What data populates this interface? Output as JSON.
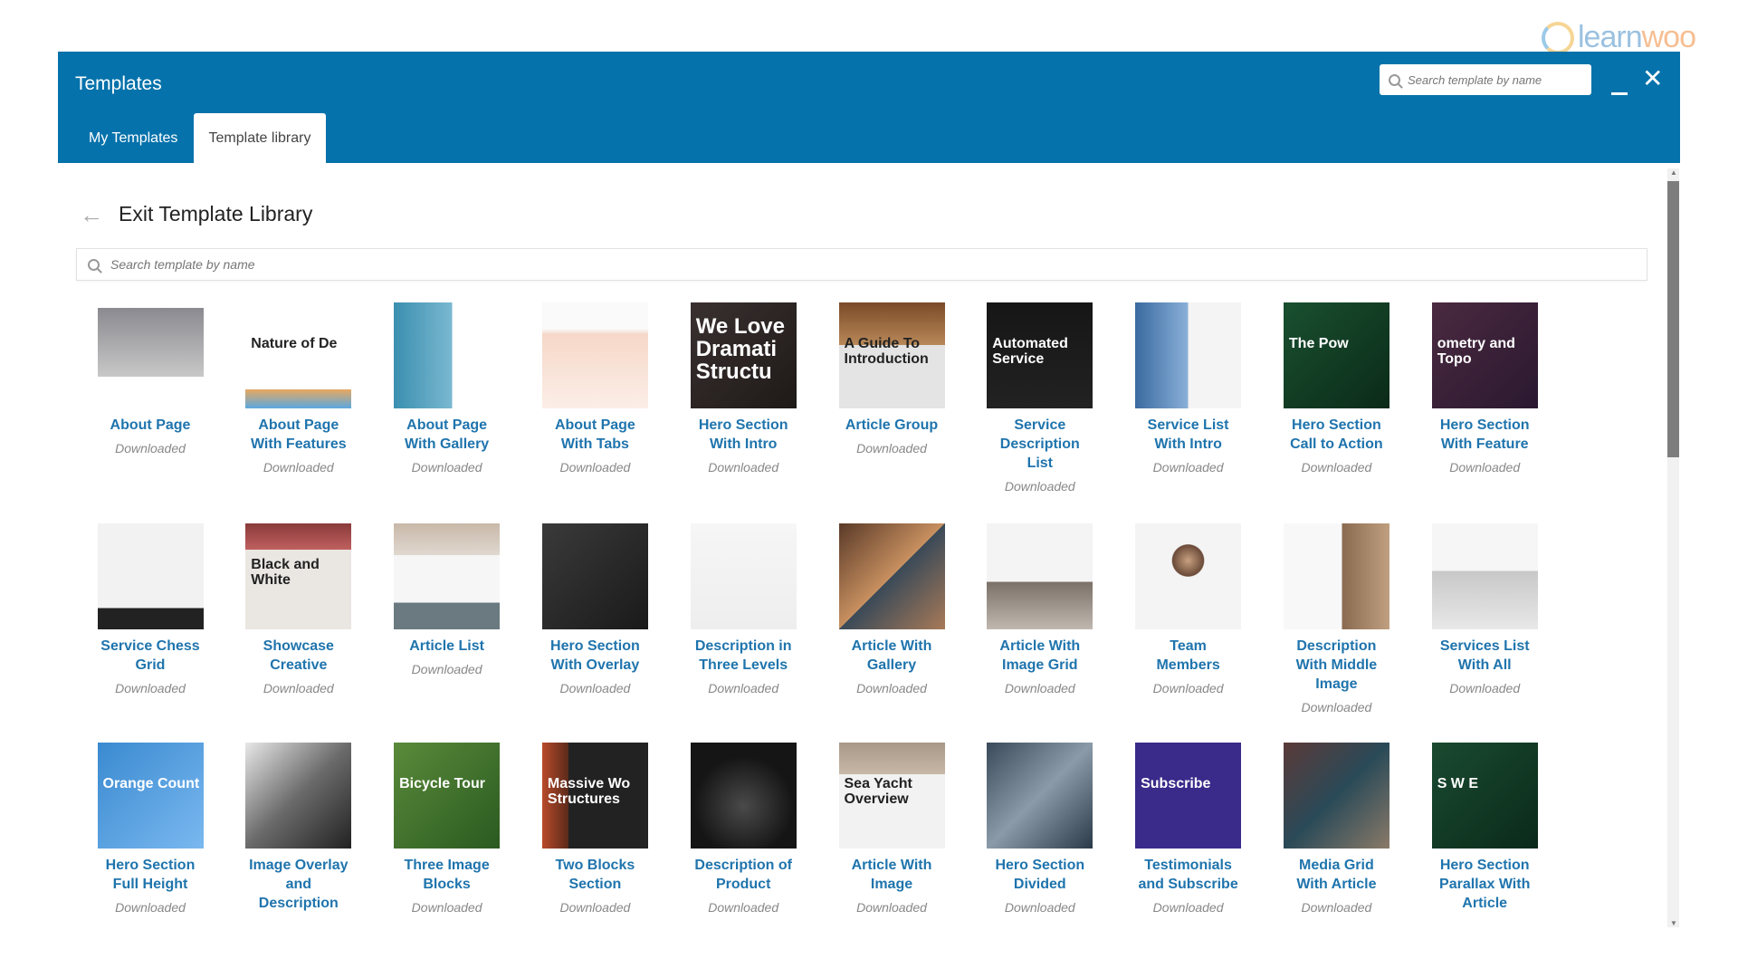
{
  "logo": {
    "text_a": "learn",
    "text_b": "woo"
  },
  "header": {
    "title": "Templates",
    "search_placeholder": "Search template by name",
    "minimize": "minimize",
    "close": "✕"
  },
  "tabs": [
    {
      "label": "My Templates",
      "active": false
    },
    {
      "label": "Template library",
      "active": true
    }
  ],
  "page": {
    "back_icon": "←",
    "title": "Exit Template Library",
    "search_placeholder": "Search template by name"
  },
  "colors": {
    "header": "#0572ab",
    "title": "#1f74ad"
  },
  "templates": [
    {
      "title": "About Page",
      "status": "Downloaded",
      "bg": "linear-gradient(#fff 0,#fff 5%,#8a8a90 5%,#c8c8c8 70%,#fff 70%)",
      "thumb_text": "",
      "tc": "#333"
    },
    {
      "title": "About Page\nWith Features",
      "status": "Downloaded",
      "bg": "linear-gradient(#fff 0,#fff 82%,#e8a860 82%,#5aa8e0 100%)",
      "thumb_text": "Nature of De",
      "tc": "#222"
    },
    {
      "title": "About Page\nWith Gallery",
      "status": "Downloaded",
      "bg": "linear-gradient(90deg,#3a8fb0 0,#7ab8d0 55%,#fff 55%)",
      "thumb_text": "",
      "tc": "#222"
    },
    {
      "title": "About Page\nWith Tabs",
      "status": "Downloaded",
      "bg": "linear-gradient(#fafafa 0,#fafafa 25%,#f6d8c8 30%,#fbeee8 100%)",
      "thumb_text": "",
      "tc": "#666"
    },
    {
      "title": "Hero Section\nWith Intro",
      "status": "Downloaded",
      "bg": "linear-gradient(135deg,#3a3030,#1e1a18)",
      "thumb_text": "We Love\nDramati\nStructu",
      "tc": "#fff"
    },
    {
      "title": "Article Group",
      "status": "Downloaded",
      "bg": "linear-gradient(#7a4a28 0,#b88858 40%,#e4e4e4 40%)",
      "thumb_text": "A Guide To\nIntroduction",
      "tc": "#222"
    },
    {
      "title": "Service\nDescription\nList",
      "status": "Downloaded",
      "bg": "linear-gradient(#161616,#222)",
      "thumb_text": "Automated\nService",
      "tc": "#fff"
    },
    {
      "title": "Service List\nWith Intro",
      "status": "Downloaded",
      "bg": "linear-gradient(90deg,#3a6aa0 0,#8ab0d8 50%,#f4f4f4 50%)",
      "thumb_text": "",
      "tc": "#222"
    },
    {
      "title": "Hero Section\nCall to Action",
      "status": "Downloaded",
      "bg": "linear-gradient(135deg,#1a5030,#0a2a18)",
      "thumb_text": "The Pow",
      "tc": "#fff"
    },
    {
      "title": "Hero Section\nWith Feature",
      "status": "Downloaded",
      "bg": "linear-gradient(135deg,#4a2a40,#2a1830)",
      "thumb_text": "ometry and Topo",
      "tc": "#fff"
    },
    {
      "title": "Service Chess\nGrid",
      "status": "Downloaded",
      "bg": "linear-gradient(#f2f2f2 0,#f2f2f2 80%,#222 80%)",
      "thumb_text": "",
      "tc": "#222"
    },
    {
      "title": "Showcase\nCreative",
      "status": "Downloaded",
      "bg": "linear-gradient(#8a3a3a 0,#c06060 25%,#eae6e2 25%)",
      "thumb_text": "Black and\nWhite",
      "tc": "#222"
    },
    {
      "title": "Article List",
      "status": "Downloaded",
      "bg": "linear-gradient(#c8b8a8 0,#e0d8d0 30%,#f6f6f6 30%,#f6f6f6 75%,#6a7a80 75%)",
      "thumb_text": "",
      "tc": "#222"
    },
    {
      "title": "Hero Section\nWith Overlay",
      "status": "Downloaded",
      "bg": "linear-gradient(135deg,#3a3a3a,#1a1a1a)",
      "thumb_text": "",
      "tc": "#fff"
    },
    {
      "title": "Description in\nThree Levels",
      "status": "Downloaded",
      "bg": "linear-gradient(#f6f6f6,#eee)",
      "thumb_text": "",
      "tc": "#222"
    },
    {
      "title": "Article With\nGallery",
      "status": "Downloaded",
      "bg": "linear-gradient(135deg,#5a3a28,#c89060 50%,#3a4a58 50%,#a87a58)",
      "thumb_text": "",
      "tc": "#fff"
    },
    {
      "title": "Article With\nImage Grid",
      "status": "Downloaded",
      "bg": "linear-gradient(#f4f4f4 0,#f4f4f4 55%,#7a7068 55%,#c0b8b0)",
      "thumb_text": "",
      "tc": "#222"
    },
    {
      "title": "Team\nMembers",
      "status": "Downloaded",
      "bg": "radial-gradient(circle at 50% 35%,#c8a080 0,#6a4a38 18%,#f4f4f4 19%)",
      "thumb_text": "",
      "tc": "#222"
    },
    {
      "title": "Description\nWith Middle\nImage",
      "status": "Downloaded",
      "bg": "linear-gradient(90deg,#f8f8f8 0,#f8f8f8 55%,#8a6a50 55%,#c0a080)",
      "thumb_text": "",
      "tc": "#222"
    },
    {
      "title": "Services List\nWith All",
      "status": "Downloaded",
      "bg": "linear-gradient(#f6f6f6 0,#f6f6f6 45%,#c8c8c8 45%,#e8e8e8)",
      "thumb_text": "",
      "tc": "#222"
    },
    {
      "title": "Hero Section\nFull Height",
      "status": "Downloaded",
      "bg": "linear-gradient(135deg,#3a8ad0,#7ab8f0)",
      "thumb_text": "Orange Count",
      "tc": "#fff"
    },
    {
      "title": "Image Overlay\nand\nDescription",
      "status": "",
      "bg": "linear-gradient(135deg,#e8e8e8,#6a6a6a 50%,#222 100%)",
      "thumb_text": "",
      "tc": "#fff"
    },
    {
      "title": "Three Image\nBlocks",
      "status": "Downloaded",
      "bg": "linear-gradient(135deg,#5a8a3a,#2a5a20)",
      "thumb_text": "Bicycle Tour",
      "tc": "#fff"
    },
    {
      "title": "Two Blocks\nSection",
      "status": "Downloaded",
      "bg": "linear-gradient(90deg,#b84a2a 0,#5a2a1a 25%,#222 25%)",
      "thumb_text": "Massive Wo\nStructures",
      "tc": "#fff"
    },
    {
      "title": "Description of\nProduct",
      "status": "Downloaded",
      "bg": "radial-gradient(circle at 50% 60%,#4a4a4a,#151515 60%)",
      "thumb_text": "",
      "tc": "#fff"
    },
    {
      "title": "Article With\nImage",
      "status": "Downloaded",
      "bg": "linear-gradient(#a89888 0,#c8b8a8 30%,#f2f2f2 30%)",
      "thumb_text": "Sea Yacht\nOverview",
      "tc": "#222"
    },
    {
      "title": "Hero Section\nDivided",
      "status": "Downloaded",
      "bg": "linear-gradient(135deg,#3a4a5a,#8a9aa8 50%,#2a3a48)",
      "thumb_text": "",
      "tc": "#fff"
    },
    {
      "title": "Testimonials\nand Subscribe",
      "status": "Downloaded",
      "bg": "linear-gradient(#3a2a8a,#3a2a8a)",
      "thumb_text": "Subscribe",
      "tc": "#fff"
    },
    {
      "title": "Media Grid\nWith Article",
      "status": "Downloaded",
      "bg": "linear-gradient(135deg,#5a3a38,#2a4a58 50%,#8a7a68)",
      "thumb_text": "",
      "tc": "#fff"
    },
    {
      "title": "Hero Section\nParallax With\nArticle",
      "status": "",
      "bg": "linear-gradient(135deg,#1a4a30,#0a2a1a)",
      "thumb_text": "S W E",
      "tc": "#fff"
    }
  ]
}
